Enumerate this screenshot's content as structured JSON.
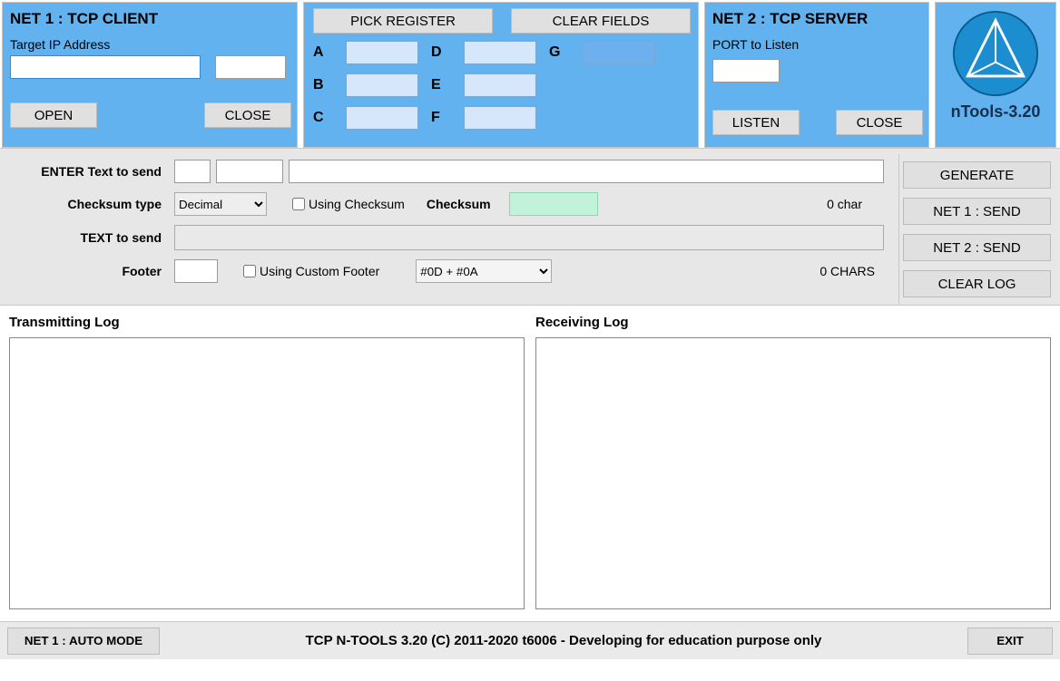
{
  "net1": {
    "title": "NET 1 : TCP CLIENT",
    "ip_label": "Target IP Address",
    "ip_value": "",
    "port_value": "",
    "open_label": "OPEN",
    "close_label": "CLOSE"
  },
  "registers": {
    "pick_label": "PICK REGISTER",
    "clear_label": "CLEAR FIELDS",
    "labels": {
      "a": "A",
      "b": "B",
      "c": "C",
      "d": "D",
      "e": "E",
      "f": "F",
      "g": "G"
    },
    "values": {
      "a": "",
      "b": "",
      "c": "",
      "d": "",
      "e": "",
      "f": "",
      "g": ""
    }
  },
  "net2": {
    "title": "NET 2 : TCP SERVER",
    "port_label": "PORT to Listen",
    "port_value": "",
    "listen_label": "LISTEN",
    "close_label": "CLOSE"
  },
  "brand": {
    "logo_name": "nTools-3.20"
  },
  "send": {
    "enter_label": "ENTER Text to send",
    "box1": "",
    "box2": "",
    "main_text": "",
    "checksum_type_label": "Checksum type",
    "checksum_type_value": "Decimal",
    "using_checksum_label": "Using Checksum",
    "using_checksum": false,
    "checksum_label": "Checksum",
    "checksum_value": "",
    "char_count": "0 char",
    "text_to_send_label": "TEXT to send",
    "text_to_send_value": "",
    "footer_label": "Footer",
    "footer_value": "",
    "using_footer_label": "Using Custom Footer",
    "using_footer": false,
    "footer_select": "#0D + #0A",
    "chars_count": "0 CHARS"
  },
  "actions": {
    "generate": "GENERATE",
    "net1_send": "NET 1 : SEND",
    "net2_send": "NET 2 : SEND",
    "clear_log": "CLEAR LOG"
  },
  "logs": {
    "tx_title": "Transmitting Log",
    "rx_title": "Receiving Log"
  },
  "status": {
    "auto_mode": "NET 1 : AUTO MODE",
    "text": "TCP N-TOOLS 3.20 (C) 2011-2020 t6006 - Developing for education purpose only",
    "exit": "EXIT"
  }
}
